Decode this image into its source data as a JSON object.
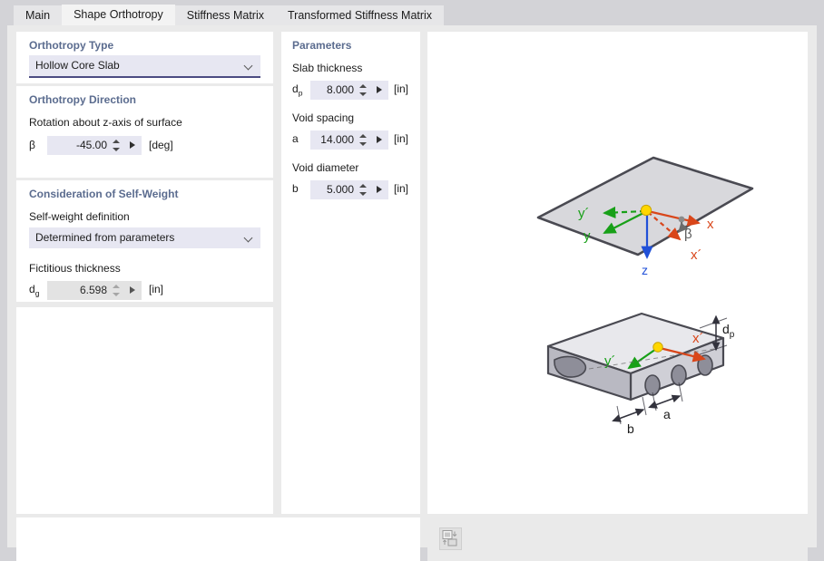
{
  "window": {
    "title": "Shape Orthotropy",
    "tabs": [
      {
        "label": "Main",
        "active": false
      },
      {
        "label": "Shape Orthotropy",
        "active": true
      },
      {
        "label": "Stiffness Matrix",
        "active": false
      },
      {
        "label": "Transformed Stiffness Matrix",
        "active": false
      }
    ]
  },
  "orthotropy_type": {
    "section_title": "Orthotropy Type",
    "value": "Hollow Core Slab",
    "chevron_icon": "chevron-down-icon"
  },
  "orthotropy_direction": {
    "section_title": "Orthotropy Direction",
    "rotation_label": "Rotation about z-axis of surface",
    "beta_symbol": "β",
    "beta_value": "-45.00",
    "beta_unit": "[deg]"
  },
  "self_weight": {
    "section_title": "Consideration of Self-Weight",
    "definition_label": "Self-weight definition",
    "definition_value": "Determined from parameters",
    "fictitious_label": "Fictitious thickness",
    "dg_symbol_base": "d",
    "dg_symbol_sub": "g",
    "dg_value": "6.598",
    "dg_unit": "[in]"
  },
  "parameters": {
    "section_title": "Parameters",
    "items": [
      {
        "label": "Slab thickness",
        "symbol_base": "d",
        "symbol_sub": "p",
        "value": "8.000",
        "unit": "[in]"
      },
      {
        "label": "Void spacing",
        "symbol_base": "a",
        "symbol_sub": "",
        "value": "14.000",
        "unit": "[in]"
      },
      {
        "label": "Void diameter",
        "symbol_base": "b",
        "symbol_sub": "",
        "value": "5.000",
        "unit": "[in]"
      }
    ]
  },
  "diagram": {
    "top": {
      "axis_x": "x",
      "axis_x_prime": "x´",
      "axis_y": "y",
      "axis_y_prime": "y´",
      "axis_z": "z",
      "angle_label": "β"
    },
    "bottom": {
      "axis_x_prime": "x´",
      "axis_y_prime": "y´",
      "dim_thickness_base": "d",
      "dim_thickness_sub": "p",
      "dim_spacing": "a",
      "dim_diameter": "b"
    },
    "colors": {
      "x_axis": "#d9461a",
      "y_axis": "#18a018",
      "z_axis": "#2050d8",
      "origin": "#ffd700",
      "slab_fill": "#d8d8dc",
      "slab_edge": "#4a4a52"
    }
  },
  "image_toolbar": {
    "save_image_icon": "save-image-icon"
  }
}
